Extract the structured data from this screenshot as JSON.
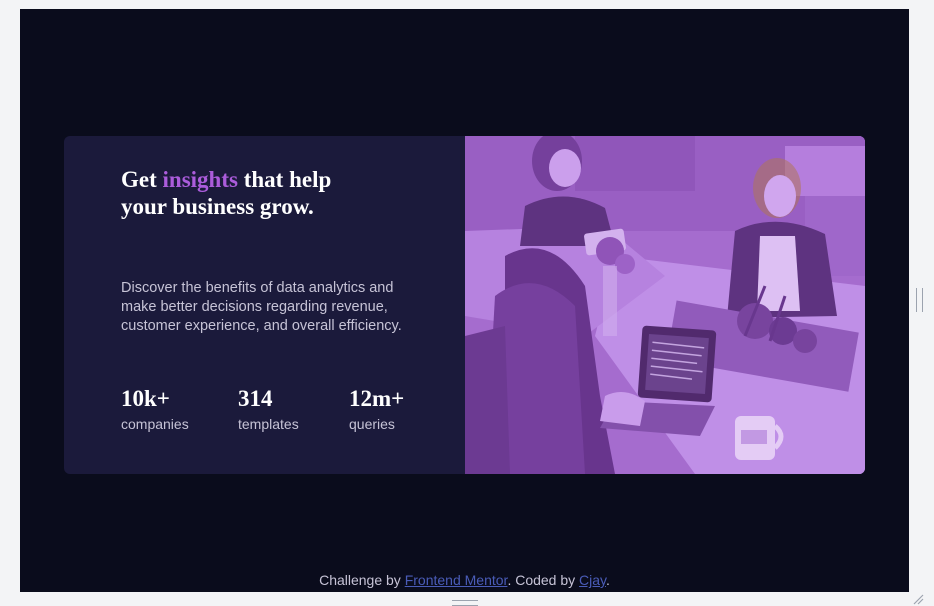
{
  "hero": {
    "headline_before": "Get ",
    "headline_accent": "insights",
    "headline_after": " that help your business grow.",
    "description": "Discover the benefits of data analytics and make better decisions regarding revenue, customer experience, and overall efficiency.",
    "stats": [
      {
        "value": "10k+",
        "label": "companies"
      },
      {
        "value": "314",
        "label": "templates"
      },
      {
        "value": "12m+",
        "label": "queries"
      }
    ]
  },
  "attribution": {
    "prefix": "Challenge by ",
    "link1": "Frontend Mentor",
    "middle": ". Coded by ",
    "link2": "Cjay",
    "suffix": "."
  },
  "colors": {
    "page_bg": "#0a0c1c",
    "card_bg": "#1b1a3b",
    "accent": "#ab5cdb",
    "text_muted": "#c6c3d6",
    "link": "#4a5cb8"
  }
}
